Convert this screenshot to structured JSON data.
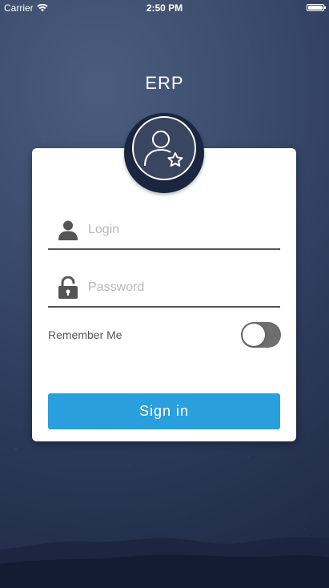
{
  "status_bar": {
    "carrier": "Carrier",
    "time": "2:50 PM",
    "battery_level": 1.0
  },
  "app": {
    "title": "ERP"
  },
  "login_form": {
    "login_placeholder": "Login",
    "login_value": "",
    "password_placeholder": "Password",
    "password_value": "",
    "remember_label": "Remember Me",
    "remember_on": false,
    "sign_in_label": "Sign in"
  },
  "icons": {
    "wifi": "wifi-icon",
    "battery": "battery-icon",
    "avatar": "user-star-icon",
    "login": "person-icon",
    "password": "lock-icon"
  },
  "colors": {
    "accent": "#2a9fde",
    "toggle_off": "#6e6e6e",
    "background": "#2f3d5e"
  }
}
